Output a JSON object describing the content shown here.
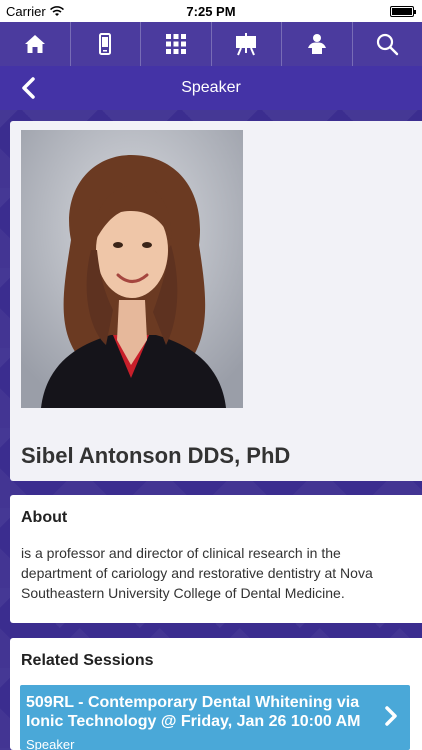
{
  "status_bar": {
    "carrier": "Carrier",
    "time": "7:25 PM",
    "wifi_icon": "wifi-icon",
    "battery_level": 1.0
  },
  "nav_icons": [
    {
      "name": "home-icon"
    },
    {
      "name": "phone-icon"
    },
    {
      "name": "grid-icon"
    },
    {
      "name": "presentation-icon"
    },
    {
      "name": "person-icon"
    },
    {
      "name": "search-icon"
    }
  ],
  "header": {
    "title": "Speaker",
    "back_icon": "chevron-left-icon"
  },
  "speaker": {
    "name": "Sibel Antonson DDS, PhD"
  },
  "about": {
    "heading": "About",
    "body": "is a professor and director of clinical research in the department of cariology and restorative dentistry at Nova Southeastern University College of Dental Medicine."
  },
  "related_sessions": {
    "heading": "Related Sessions",
    "items": [
      {
        "title": "509RL - Contemporary Dental Whitening via Ionic Technology @ Friday, Jan 26 10:00 AM",
        "role": "Speaker"
      }
    ]
  },
  "colors": {
    "nav_bg": "#4b3b9e",
    "title_bg": "#4433a6",
    "page_bg": "#3b2d8f",
    "session_bg": "#4aa8d8"
  }
}
